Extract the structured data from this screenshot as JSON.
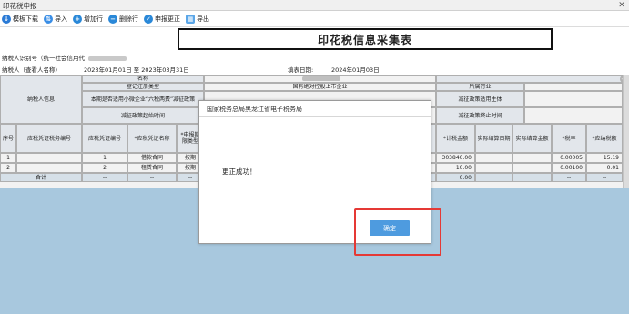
{
  "window": {
    "title": "印花税申报",
    "close_label": "✕"
  },
  "toolbar": {
    "items": [
      {
        "label": "模板下载",
        "icon": "download-icon"
      },
      {
        "label": "导入",
        "icon": "import-icon"
      },
      {
        "label": "增加行",
        "icon": "add-row-icon"
      },
      {
        "label": "删除行",
        "icon": "delete-row-icon"
      },
      {
        "label": "申报更正",
        "icon": "correction-icon"
      },
      {
        "label": "导出",
        "icon": "export-icon"
      }
    ]
  },
  "form": {
    "title": "印花税信息采集表",
    "taxpayer_id_label": "纳税人识别号（统一社会信用代",
    "taxpayer_name_label": "纳税人（查看人名称）",
    "period": "2023年01月01日 至 2023年03月31日",
    "fill_date_label": "填表日期:",
    "fill_date": "2024年01月03日"
  },
  "info_block": {
    "taxpayer_info": "纳税人信息",
    "name_label": "名称",
    "reg_type_label": "登记注册类型",
    "reg_type_value": "国有绝对控股上市企业",
    "industry_label": "所属行业",
    "small_biz_label": "本期是否适用小微企业“六税两费”减征政策",
    "reduction_subject_label": "减征政策适用主体",
    "reduction_start_label": "减征政策起始时间",
    "reduction_end_label": "减征政策终止时间"
  },
  "table": {
    "headers": [
      "序号",
      "应税凭证税务编号",
      "应税凭证编号",
      "*应税凭证名称",
      "*申报期限类型",
      "*计税金额",
      "实际结算日期",
      "实际结算金额",
      "*税率",
      "*应纳税额"
    ],
    "rows": [
      {
        "seq": "1",
        "tax_no": "",
        "voucher_no": "1",
        "name": "借款合同",
        "period_type": "按期",
        "amount": "303840.00",
        "settle_date": "",
        "settle_amount": "",
        "rate": "0.00005",
        "tax": "15.19"
      },
      {
        "seq": "2",
        "tax_no": "",
        "voucher_no": "2",
        "name": "租赁合同",
        "period_type": "按期",
        "amount": "10.00",
        "settle_date": "",
        "settle_amount": "",
        "rate": "0.00100",
        "tax": "0.01"
      }
    ],
    "total": {
      "label": "合计",
      "dash1": "--",
      "dash2": "--",
      "dash3": "--",
      "amount": "0.00",
      "dash4": "--",
      "dash5": "--"
    }
  },
  "dialog": {
    "title": "国家税务总局黑龙江省电子税务局",
    "message": "更正成功！",
    "ok_label": "确定"
  },
  "colors": {
    "accent": "#4e9bdf",
    "highlight": "#e53935",
    "background_blue": "#a8c8de"
  }
}
